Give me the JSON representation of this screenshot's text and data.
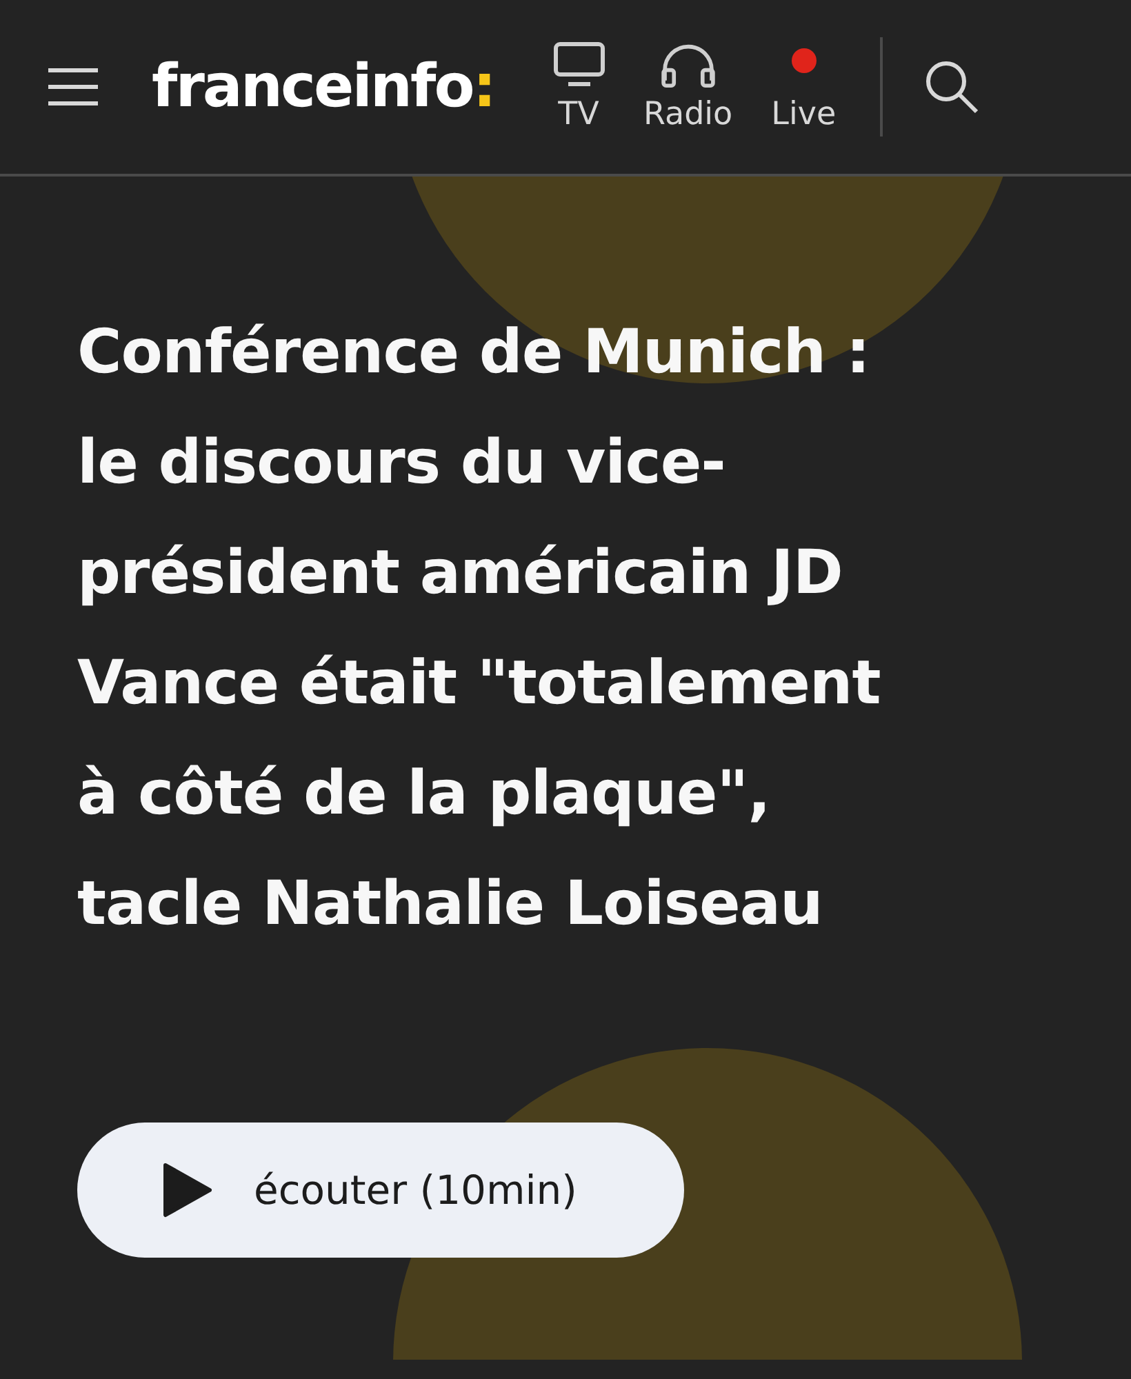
{
  "header": {
    "logo": {
      "name": "franceinfo",
      "mark": ":"
    },
    "nav": [
      {
        "kind": "tv",
        "label": "TV"
      },
      {
        "kind": "radio",
        "label": "Radio"
      },
      {
        "kind": "live",
        "label": "Live"
      }
    ]
  },
  "article": {
    "headline_lines": [
      "Conférence de Munich :",
      "le discours du vice-",
      "président américain JD",
      "Vance était \"totalement",
      "à côté de la plaque\",",
      "tacle Nathalie Loiseau"
    ],
    "listen_button": "écouter (10min)"
  }
}
